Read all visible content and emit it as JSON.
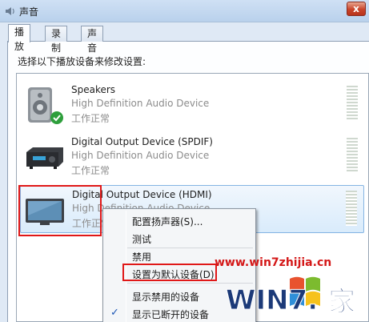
{
  "window": {
    "title": "声音",
    "close_label": "x"
  },
  "tabs": [
    {
      "label": "播放",
      "active": true
    },
    {
      "label": "录制",
      "active": false
    },
    {
      "label": "声音",
      "active": false
    }
  ],
  "instruction": "选择以下播放设备来修改设置:",
  "devices": [
    {
      "name": "Speakers",
      "description": "High Definition Audio Device",
      "status": "工作正常",
      "icon": "speaker-icon",
      "default": true
    },
    {
      "name": "Digital Output Device (SPDIF)",
      "description": "High Definition Audio Device",
      "status": "工作正常",
      "icon": "receiver-icon",
      "default": false
    },
    {
      "name": "Digital Output Device (HDMI)",
      "description": "High Definition Audio Device",
      "status": "工作正常",
      "icon": "monitor-icon",
      "selected": true
    }
  ],
  "context_menu": {
    "items": [
      {
        "label": "配置扬声器(S)..."
      },
      {
        "label": "测试"
      },
      {
        "label": "禁用"
      },
      {
        "label": "设置为默认设备(D)",
        "highlighted": true
      },
      {
        "label": "显示禁用的设备"
      },
      {
        "label": "显示已断开的设备",
        "checked": true
      }
    ]
  },
  "watermark": {
    "url": "www.win7zhijia.cn",
    "brand": "WIN7.家"
  },
  "colors": {
    "accent": "#84b4e3",
    "highlight_box": "#e01818",
    "watermark": "#d41818"
  }
}
